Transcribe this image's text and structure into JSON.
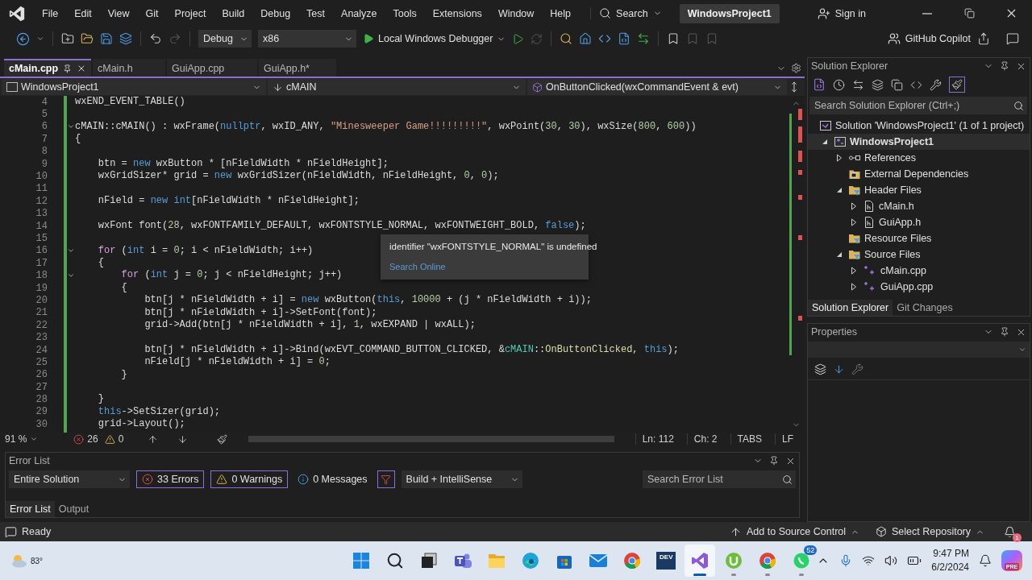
{
  "window": {
    "title": "WindowsProject1"
  },
  "menu": [
    "File",
    "Edit",
    "View",
    "Git",
    "Project",
    "Build",
    "Debug",
    "Test",
    "Analyze",
    "Tools",
    "Extensions",
    "Window",
    "Help"
  ],
  "search": {
    "label": "Search"
  },
  "sign_in": "Sign in",
  "toolbar": {
    "configuration": "Debug",
    "platform": "x86",
    "run_target": "Local Windows Debugger",
    "copilot": "GitHub Copilot"
  },
  "editor_tabs": [
    {
      "label": "cMain.cpp",
      "selected": true
    },
    {
      "label": "cMain.h",
      "selected": false
    },
    {
      "label": "GuiApp.cpp",
      "selected": false
    },
    {
      "label": "GuiApp.h*",
      "selected": false
    }
  ],
  "nav_bar": {
    "project": "WindowsProject1",
    "scope": "cMAIN",
    "member": "OnButtonClicked(wxCommandEvent & evt)"
  },
  "code_lines": [
    {
      "number": "4",
      "fold": false,
      "tokens": [
        {
          "text": "wxEND_EVENT_TABLE()",
          "kind": "plain"
        }
      ]
    },
    {
      "number": "5",
      "fold": false
    },
    {
      "number": "6",
      "fold": true,
      "tokens": [
        {
          "text": "cMAIN::cMAIN() : wxFrame(",
          "kind": "plain"
        },
        {
          "text": "nullptr",
          "kind": "keyword"
        },
        {
          "text": ", wxID_ANY, ",
          "kind": "plain"
        },
        {
          "text": "\"Minesweeper Game!!!!!!!!!\"",
          "kind": "string"
        },
        {
          "text": ", wxPoint(",
          "kind": "plain"
        },
        {
          "text": "30",
          "kind": "number"
        },
        {
          "text": ", ",
          "kind": "plain"
        },
        {
          "text": "30",
          "kind": "number"
        },
        {
          "text": "), wxSize(",
          "kind": "plain"
        },
        {
          "text": "800",
          "kind": "number"
        },
        {
          "text": ", ",
          "kind": "plain"
        },
        {
          "text": "600",
          "kind": "number"
        },
        {
          "text": "))",
          "kind": "plain"
        }
      ]
    },
    {
      "number": "7",
      "fold": false,
      "tokens": [
        {
          "text": "{",
          "kind": "plain"
        }
      ]
    },
    {
      "number": "8",
      "fold": false
    },
    {
      "number": "9",
      "fold": false,
      "tokens": [
        {
          "text": "    btn = ",
          "kind": "plain"
        },
        {
          "text": "new",
          "kind": "keyword"
        },
        {
          "text": " wxButton * [nFieldWidth * nFieldHeight];",
          "kind": "plain"
        }
      ]
    },
    {
      "number": "10",
      "fold": false,
      "tokens": [
        {
          "text": "    wxGridSizer* grid = ",
          "kind": "plain"
        },
        {
          "text": "new",
          "kind": "keyword"
        },
        {
          "text": " wxGridSizer(nFieldWidth, nFieldHeight, ",
          "kind": "plain"
        },
        {
          "text": "0",
          "kind": "number"
        },
        {
          "text": ", ",
          "kind": "plain"
        },
        {
          "text": "0",
          "kind": "number"
        },
        {
          "text": ");",
          "kind": "plain"
        }
      ]
    },
    {
      "number": "11",
      "fold": false
    },
    {
      "number": "12",
      "fold": false,
      "tokens": [
        {
          "text": "    nField = ",
          "kind": "plain"
        },
        {
          "text": "new",
          "kind": "keyword"
        },
        {
          "text": " int",
          "kind": "keyword"
        },
        {
          "text": "[nFieldWidth * nFieldHeight];",
          "kind": "plain"
        }
      ]
    },
    {
      "number": "13",
      "fold": false
    },
    {
      "number": "14",
      "fold": false,
      "tokens": [
        {
          "text": "    wxFont font(",
          "kind": "plain"
        },
        {
          "text": "28",
          "kind": "number"
        },
        {
          "text": ", wxFONTFAMILY_DEFAULT, wxFONTSTYLE_NORMAL, wxFONTWEIGHT_BOLD, ",
          "kind": "plain"
        },
        {
          "text": "false",
          "kind": "keyword"
        },
        {
          "text": ");",
          "kind": "plain"
        }
      ]
    },
    {
      "number": "15",
      "fold": false
    },
    {
      "number": "16",
      "fold": true,
      "tokens": [
        {
          "text": "    for",
          "kind": "control"
        },
        {
          "text": " (",
          "kind": "plain"
        },
        {
          "text": "int",
          "kind": "keyword"
        },
        {
          "text": " i = ",
          "kind": "plain"
        },
        {
          "text": "0",
          "kind": "number"
        },
        {
          "text": "; i < nFieldWidth; i++)",
          "kind": "plain"
        }
      ]
    },
    {
      "number": "17",
      "fold": false,
      "tokens": [
        {
          "text": "    {",
          "kind": "plain"
        }
      ]
    },
    {
      "number": "18",
      "fold": true,
      "tokens": [
        {
          "text": "        for",
          "kind": "control"
        },
        {
          "text": " (",
          "kind": "plain"
        },
        {
          "text": "int",
          "kind": "keyword"
        },
        {
          "text": " j = ",
          "kind": "plain"
        },
        {
          "text": "0",
          "kind": "number"
        },
        {
          "text": "; j < nFieldHeight; j++)",
          "kind": "plain"
        }
      ]
    },
    {
      "number": "19",
      "fold": false,
      "tokens": [
        {
          "text": "        {",
          "kind": "plain"
        }
      ]
    },
    {
      "number": "20",
      "fold": false,
      "tokens": [
        {
          "text": "            btn[j * nFieldWidth + i] = ",
          "kind": "plain"
        },
        {
          "text": "new",
          "kind": "keyword"
        },
        {
          "text": " wxButton(",
          "kind": "plain"
        },
        {
          "text": "this",
          "kind": "keyword"
        },
        {
          "text": ", ",
          "kind": "plain"
        },
        {
          "text": "10000",
          "kind": "number"
        },
        {
          "text": " + (j * nFieldWidth + i));",
          "kind": "plain"
        }
      ]
    },
    {
      "number": "21",
      "fold": false,
      "tokens": [
        {
          "text": "            btn[j * nFieldWidth + i]->SetFont(font);",
          "kind": "plain"
        }
      ]
    },
    {
      "number": "22",
      "fold": false,
      "tokens": [
        {
          "text": "            grid->Add(btn[j * nFieldWidth + i], ",
          "kind": "plain"
        },
        {
          "text": "1",
          "kind": "number"
        },
        {
          "text": ", wxEXPAND | wxALL);",
          "kind": "plain"
        }
      ]
    },
    {
      "number": "23",
      "fold": false
    },
    {
      "number": "24",
      "fold": false,
      "tokens": [
        {
          "text": "            btn[j * nFieldWidth + i]->Bind(wxEVT_COMMAND_BUTTON_CLICKED, &",
          "kind": "plain"
        },
        {
          "text": "cMAIN",
          "kind": "type"
        },
        {
          "text": "::",
          "kind": "plain"
        },
        {
          "text": "OnButtonClicked",
          "kind": "function"
        },
        {
          "text": ", ",
          "kind": "plain"
        },
        {
          "text": "this",
          "kind": "keyword"
        },
        {
          "text": ");",
          "kind": "plain"
        }
      ]
    },
    {
      "number": "25",
      "fold": false,
      "tokens": [
        {
          "text": "            nField[j * nFieldWidth + i] = ",
          "kind": "plain"
        },
        {
          "text": "0",
          "kind": "number"
        },
        {
          "text": ";",
          "kind": "plain"
        }
      ]
    },
    {
      "number": "26",
      "fold": false,
      "tokens": [
        {
          "text": "        }",
          "kind": "plain"
        }
      ]
    },
    {
      "number": "27",
      "fold": false
    },
    {
      "number": "28",
      "fold": false,
      "tokens": [
        {
          "text": "    }",
          "kind": "plain"
        }
      ]
    },
    {
      "number": "29",
      "fold": false,
      "tokens": [
        {
          "text": "    this",
          "kind": "keyword"
        },
        {
          "text": "->SetSizer(grid);",
          "kind": "plain"
        }
      ]
    },
    {
      "number": "30",
      "fold": false,
      "tokens": [
        {
          "text": "    grid->Layout();",
          "kind": "plain"
        }
      ]
    }
  ],
  "tooltip": {
    "message": "identifier \"wxFONTSTYLE_NORMAL\" is undefined",
    "link": "Search Online"
  },
  "editor_status": {
    "zoom": "91 %",
    "errors": "26",
    "warnings": "0",
    "line": "Ln: 112",
    "column": "Ch: 2",
    "indent": "TABS",
    "line_ending": "LF"
  },
  "error_list": {
    "title": "Error List",
    "scope": "Entire Solution",
    "errors": "33 Errors",
    "warnings": "0 Warnings",
    "messages": "0 Messages",
    "source": "Build + IntelliSense",
    "search_placeholder": "Search Error List",
    "tabs": [
      {
        "label": "Error List",
        "selected": true
      },
      {
        "label": "Output",
        "selected": false
      }
    ]
  },
  "solution_explorer": {
    "title": "Solution Explorer",
    "search_placeholder": "Search Solution Explorer (Ctrl+;)",
    "tree": [
      {
        "label": "Solution 'WindowsProject1' (1 of 1 project)",
        "kind": "solution",
        "expandable": false,
        "expanded": true,
        "selected": false,
        "children": [
          {
            "label": "WindowsProject1",
            "kind": "project",
            "expandable": true,
            "expanded": true,
            "selected": true,
            "children": [
              {
                "label": "References",
                "kind": "references",
                "expandable": true,
                "expanded": false,
                "selected": false
              },
              {
                "label": "External Dependencies",
                "kind": "dependencies",
                "expandable": false,
                "selected": false
              },
              {
                "label": "Header Files",
                "kind": "folder",
                "expandable": true,
                "expanded": true,
                "selected": false,
                "children": [
                  {
                    "label": "cMain.h",
                    "kind": "header",
                    "expandable": true,
                    "expanded": false,
                    "selected": false
                  },
                  {
                    "label": "GuiApp.h",
                    "kind": "header",
                    "expandable": true,
                    "expanded": false,
                    "selected": false
                  }
                ]
              },
              {
                "label": "Resource Files",
                "kind": "folder",
                "expandable": false,
                "selected": false
              },
              {
                "label": "Source Files",
                "kind": "folder",
                "expandable": true,
                "expanded": true,
                "selected": false,
                "children": [
                  {
                    "label": "cMain.cpp",
                    "kind": "source",
                    "expandable": true,
                    "expanded": false,
                    "selected": false
                  },
                  {
                    "label": "GuiApp.cpp",
                    "kind": "source",
                    "expandable": true,
                    "expanded": false,
                    "selected": false
                  }
                ]
              }
            ]
          }
        ]
      }
    ],
    "tabs": [
      {
        "label": "Solution Explorer",
        "selected": true
      },
      {
        "label": "Git Changes",
        "selected": false
      }
    ]
  },
  "properties": {
    "title": "Properties"
  },
  "status_bar": {
    "status": "Ready",
    "source_control": "Add to Source Control",
    "repository": "Select Repository",
    "notifications": "1"
  },
  "taskbar": {
    "weather": "83°",
    "time": "9:47 PM",
    "date": "6/2/2024",
    "copilot_label": "PRE",
    "apps": [
      {
        "kind": "start",
        "selected": false,
        "running": false
      },
      {
        "kind": "search",
        "selected": false,
        "running": false
      },
      {
        "kind": "taskview",
        "selected": false,
        "running": false
      },
      {
        "kind": "teams",
        "selected": false,
        "running": false
      },
      {
        "kind": "explorer",
        "selected": false,
        "running": false
      },
      {
        "kind": "edge",
        "selected": false,
        "running": false
      },
      {
        "kind": "store",
        "selected": false,
        "running": false
      },
      {
        "kind": "mail",
        "selected": false,
        "running": false
      },
      {
        "kind": "chrome",
        "selected": false,
        "running": false
      },
      {
        "kind": "devhome",
        "label": "DEV",
        "selected": false,
        "running": false
      },
      {
        "kind": "visualstudio",
        "selected": true,
        "running": true
      },
      {
        "kind": "torrent",
        "selected": false,
        "running": true
      },
      {
        "kind": "chrome",
        "selected": false,
        "running": true
      },
      {
        "kind": "whatsapp",
        "badge": "52",
        "selected": false,
        "running": true
      }
    ]
  }
}
